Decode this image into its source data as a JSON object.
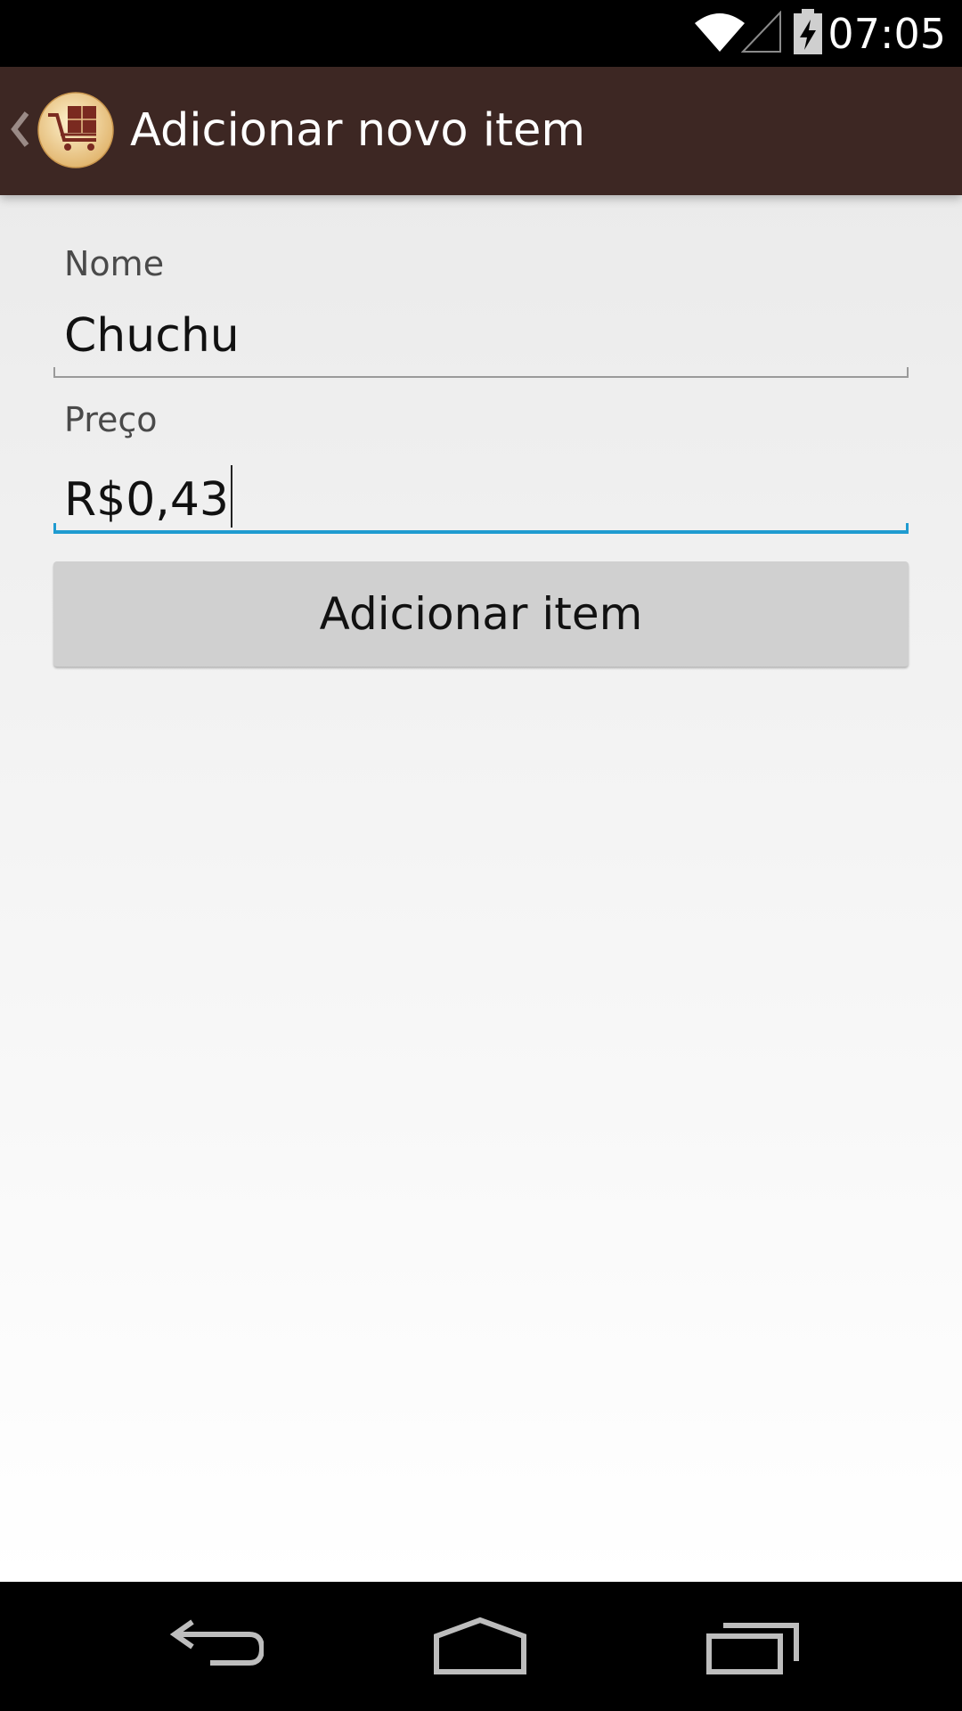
{
  "status_bar": {
    "time": "07:05",
    "icons": [
      "wifi-icon",
      "signal-icon",
      "battery-charging-icon"
    ]
  },
  "action_bar": {
    "title": "Adicionar novo item",
    "icons": [
      "back-caret-icon",
      "shopping-cart-calculator-icon"
    ],
    "color": "#3d2723"
  },
  "form": {
    "nome_label": "Nome",
    "nome_value": "Chuchu",
    "preco_label": "Preço",
    "preco_value": "R$0,43",
    "add_button_label": "Adicionar item",
    "focus_color": "#1f9bd0"
  },
  "nav_bar": {
    "icons": [
      "back-icon",
      "home-icon",
      "recents-icon"
    ]
  }
}
